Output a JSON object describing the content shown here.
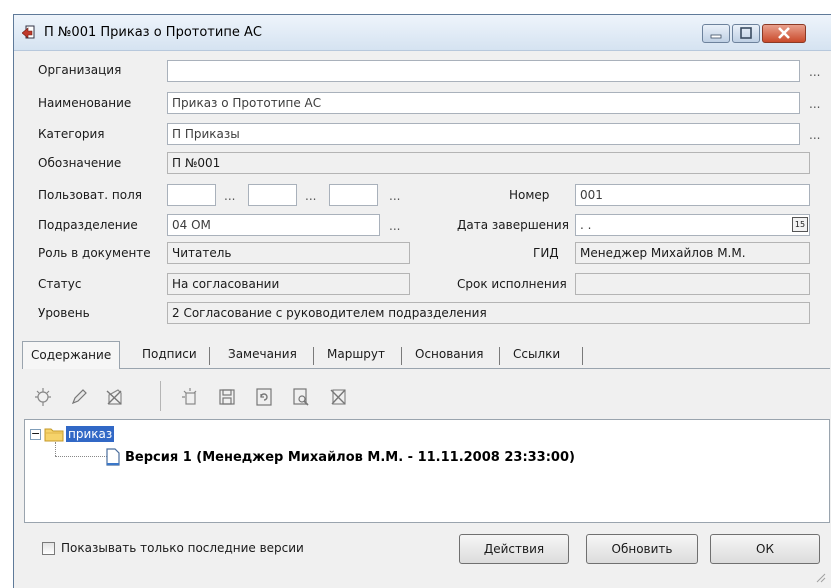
{
  "window": {
    "title": "П №001 Приказ о Прототипе АС"
  },
  "fields": {
    "organization_label": "Организация",
    "organization_value": "",
    "name_label": "Наименование",
    "name_value": "Приказ о Прототипе АС",
    "category_label": "Категория",
    "category_value": "П Приказы",
    "designation_label": "Обозначение",
    "designation_value": "П №001",
    "user_fields_label": "Пользоват. поля",
    "number_label": "Номер",
    "number_value": "001",
    "department_label": "Подразделение",
    "department_value": "04 ОМ",
    "end_date_label": "Дата завершения",
    "end_date_value": " .  .",
    "role_label": "Роль в документе",
    "role_value": "Читатель",
    "gid_label": "ГИД",
    "gid_value": "Менеджер Михайлов М.М.",
    "status_label": "Статус",
    "status_value": "На согласовании",
    "deadline_label": "Срок исполнения",
    "deadline_value": "",
    "level_label": "Уровень",
    "level_value": "2 Согласование с руководителем подразделения",
    "ellipsis": "...",
    "calendar_glyph": "15"
  },
  "tabs": [
    "Содержание",
    "Подписи",
    "Замечания",
    "Маршрут",
    "Основания",
    "Ссылки"
  ],
  "tree": {
    "root_label": "приказ",
    "child_label": "Версия 1 (Менеджер Михайлов М.М. - 11.11.2008 23:33:00)",
    "expander": "−"
  },
  "footer": {
    "show_last_versions_label": "Показывать только последние версии",
    "actions_button": "Действия",
    "refresh_button": "Обновить",
    "ok_button": "ОК"
  }
}
